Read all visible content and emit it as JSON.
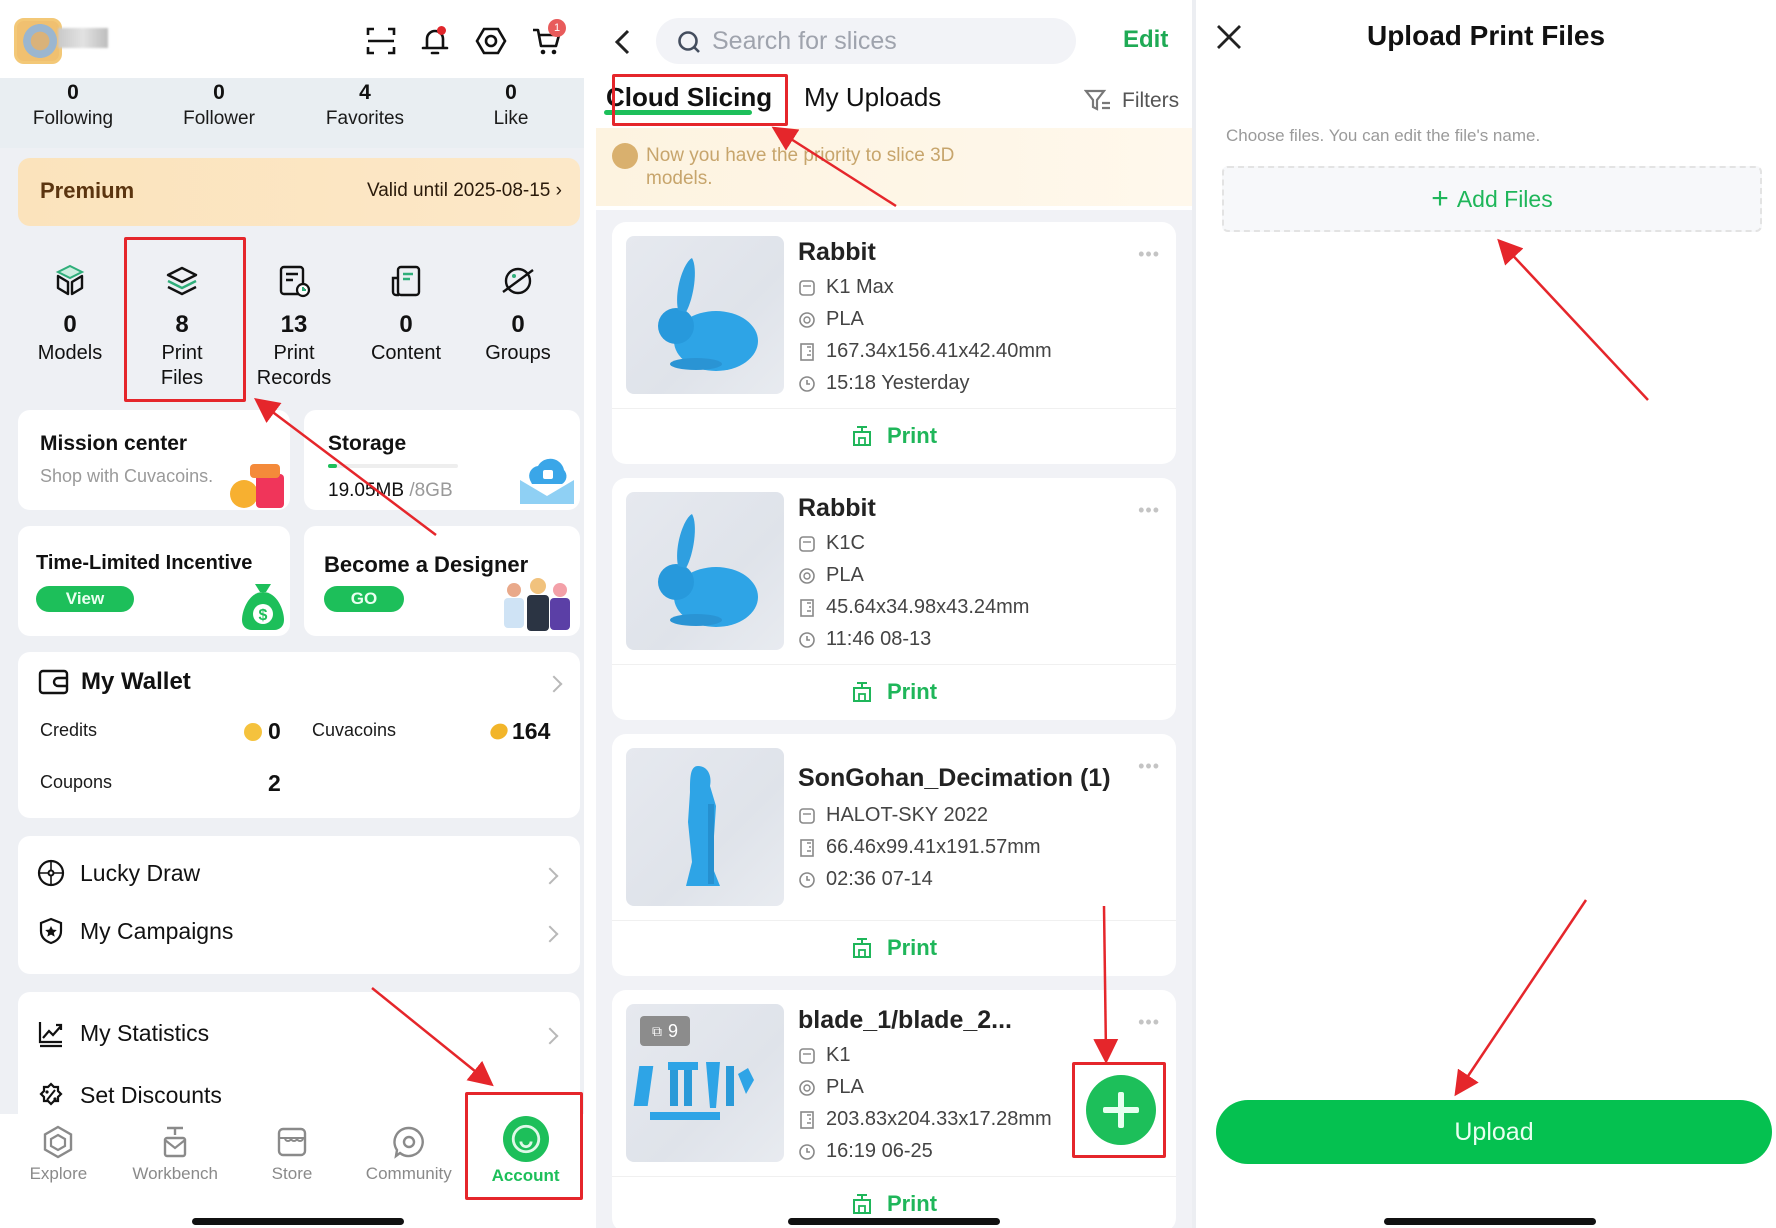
{
  "account": {
    "header_icons": [
      "scan-icon",
      "bell-icon",
      "settings-icon",
      "cart-icon"
    ],
    "cart_badge": "1",
    "stats": [
      {
        "num": "0",
        "label": "Following"
      },
      {
        "num": "0",
        "label": "Follower"
      },
      {
        "num": "4",
        "label": "Favorites"
      },
      {
        "num": "0",
        "label": "Like"
      }
    ],
    "premium": {
      "title": "Premium",
      "valid": "Valid until 2025-08-15"
    },
    "tiles": [
      {
        "num": "0",
        "label": "Models"
      },
      {
        "num": "8",
        "label": "Print Files"
      },
      {
        "num": "13",
        "label": "Print Records"
      },
      {
        "num": "0",
        "label": "Content"
      },
      {
        "num": "0",
        "label": "Groups"
      }
    ],
    "mission": {
      "title": "Mission center",
      "subtitle": "Shop with Cuvacoins."
    },
    "storage": {
      "title": "Storage",
      "used": "19.05MB",
      "total": " /8GB",
      "used_fraction": 0.0023
    },
    "incentive": {
      "title": "Time-Limited Incentive",
      "button": "View"
    },
    "designer": {
      "title": "Become a Designer",
      "button": "GO"
    },
    "wallet": {
      "title": "My Wallet",
      "credits_label": "Credits",
      "credits_value": "0",
      "cuvacoins_label": "Cuvacoins",
      "cuvacoins_value": "164",
      "coupons_label": "Coupons",
      "coupons_value": "2"
    },
    "menu1": [
      "Lucky Draw",
      "My Campaigns"
    ],
    "menu2": [
      "My Statistics",
      "Set Discounts"
    ],
    "tabs": [
      "Explore",
      "Workbench",
      "Store",
      "Community",
      "Account"
    ],
    "active_tab": "Account"
  },
  "slices": {
    "search_placeholder": "Search for slices",
    "edit": "Edit",
    "tabs": [
      "Cloud Slicing",
      "My Uploads"
    ],
    "active_tab": "Cloud Slicing",
    "filters": "Filters",
    "notice": "Now you have the priority to slice 3D models.",
    "files": [
      {
        "name": "Rabbit",
        "printer": "K1 Max",
        "material": "PLA",
        "size": "167.34x156.41x42.40mm",
        "time": "15:18 Yesterday"
      },
      {
        "name": "Rabbit",
        "printer": "K1C",
        "material": "PLA",
        "size": "45.64x34.98x43.24mm",
        "time": "11:46 08-13"
      },
      {
        "name": "SonGohan_Decimation (1)",
        "printer": "HALOT-SKY 2022",
        "material": null,
        "size": "66.46x99.41x191.57mm",
        "time": "02:36 07-14"
      },
      {
        "name": "blade_1/blade_2...",
        "printer": "K1",
        "material": "PLA",
        "size": "203.83x204.33x17.28mm",
        "time": "16:19 06-25",
        "count": "9"
      }
    ],
    "print_label": "Print"
  },
  "upload": {
    "title": "Upload Print Files",
    "hint": "Choose files. You can edit the file's name.",
    "add_files": "Add Files",
    "upload_button": "Upload"
  },
  "colors": {
    "accent": "#1dbf5a",
    "annotation": "#e5262b",
    "premium_bg": "#fbe3bc"
  }
}
